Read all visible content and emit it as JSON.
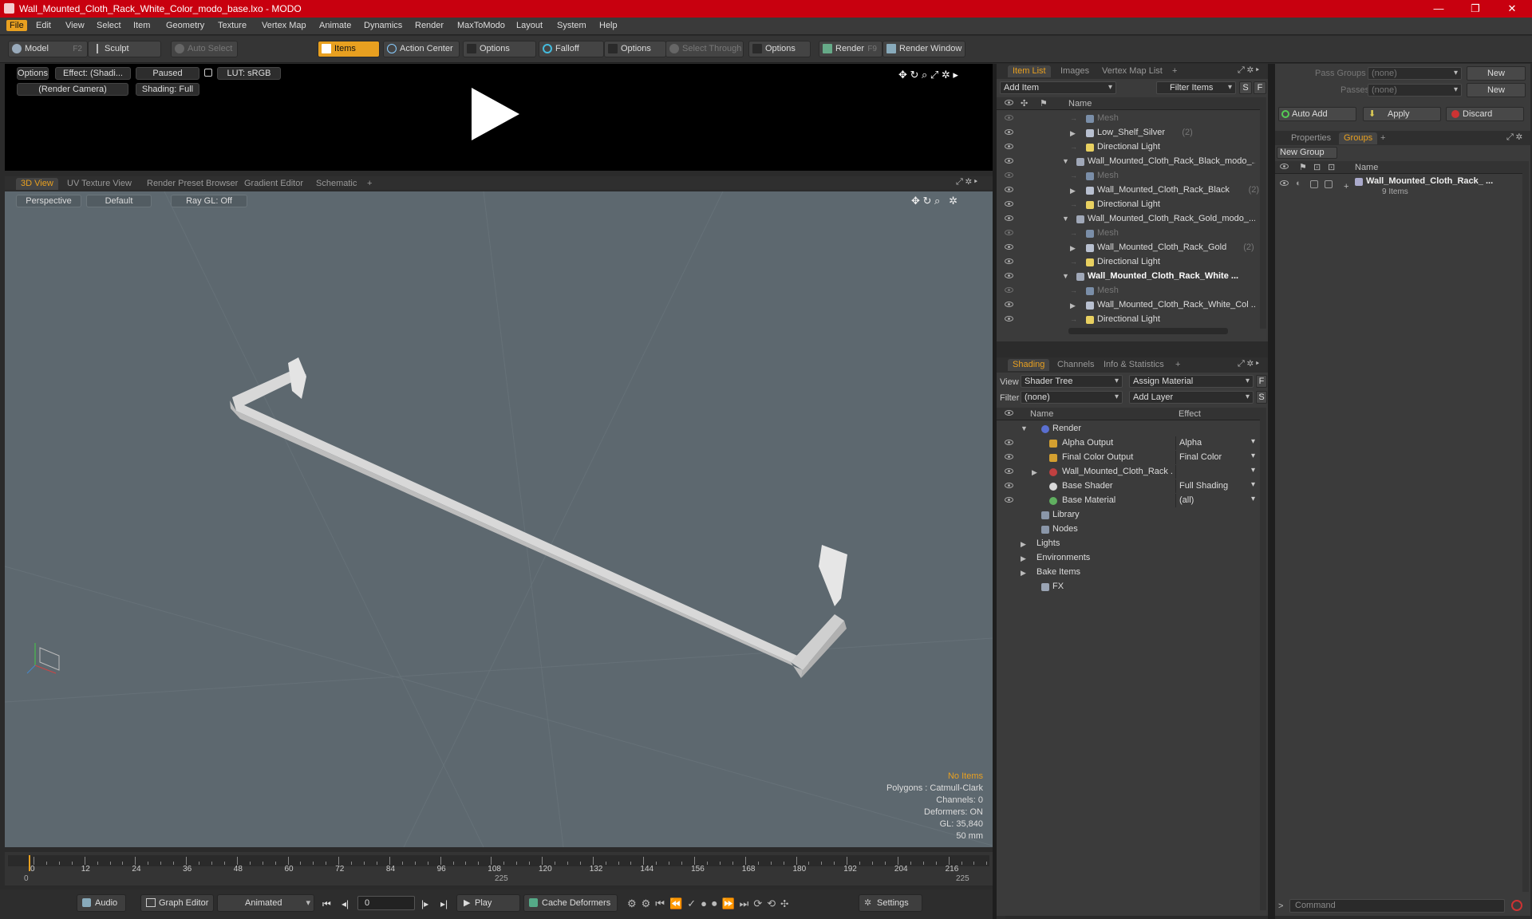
{
  "window": {
    "title": "Wall_Mounted_Cloth_Rack_White_Color_modo_base.lxo - MODO",
    "controls": [
      "—",
      "❐",
      "✕"
    ]
  },
  "menu": [
    "File",
    "Edit",
    "View",
    "Select",
    "Item",
    "Geometry",
    "Texture",
    "Vertex Map",
    "Animate",
    "Dynamics",
    "Render",
    "MaxToModo",
    "Layout",
    "System",
    "Help"
  ],
  "toolbar": {
    "model": "Model",
    "model_key": "F2",
    "sculpt": "Sculpt",
    "auto_select": "Auto Select",
    "items": "Items",
    "action_center": "Action Center",
    "options1": "Options",
    "falloff": "Falloff",
    "options2": "Options",
    "select_through": "Select Through",
    "options3": "Options",
    "render": "Render",
    "render_key": "F9",
    "render_window": "Render Window"
  },
  "preview": {
    "options": "Options",
    "effect": "Effect: (Shadi...",
    "paused": "Paused",
    "lut": "LUT: sRGB",
    "camera": "(Render Camera)",
    "shading": "Shading: Full"
  },
  "view_tabs": [
    "3D View",
    "UV Texture View",
    "Render Preset Browser",
    "Gradient Editor",
    "Schematic",
    "+"
  ],
  "viewport": {
    "perspective": "Perspective",
    "default": "Default",
    "raygl": "Ray GL: Off",
    "hud": {
      "no_items": "No Items",
      "polygons": "Polygons : Catmull-Clark",
      "channels": "Channels: 0",
      "deformers": "Deformers: ON",
      "gl": "GL: 35,840",
      "size": "50 mm"
    }
  },
  "timeline": {
    "ticks": [
      "0",
      "12",
      "24",
      "36",
      "48",
      "60",
      "72",
      "84",
      "96",
      "108",
      "120",
      "132",
      "144",
      "156",
      "168",
      "180",
      "192",
      "204",
      "216"
    ],
    "start": "0",
    "mid": "225",
    "end": "225"
  },
  "transport": {
    "audio": "Audio",
    "graph_editor": "Graph Editor",
    "animated": "Animated",
    "frame": "0",
    "play": "Play",
    "cache": "Cache Deformers",
    "settings": "Settings"
  },
  "item_list": {
    "tabs": [
      "Item List",
      "Images",
      "Vertex Map List",
      "+"
    ],
    "add_item": "Add Item",
    "filter_items": "Filter Items",
    "s": "S",
    "f": "F",
    "col_name": "Name",
    "rows": [
      {
        "label": "Mesh",
        "indent": 2,
        "kind": "mesh",
        "count": ""
      },
      {
        "label": "Low_Shelf_Silver",
        "indent": 2,
        "kind": "group",
        "count": "(2)"
      },
      {
        "label": "Directional Light",
        "indent": 2,
        "kind": "light",
        "count": ""
      },
      {
        "label": "Wall_Mounted_Cloth_Rack_Black_modo_...",
        "indent": 1,
        "kind": "scene",
        "count": ""
      },
      {
        "label": "Mesh",
        "indent": 2,
        "kind": "mesh",
        "count": ""
      },
      {
        "label": "Wall_Mounted_Cloth_Rack_Black",
        "indent": 2,
        "kind": "group",
        "count": "(2)"
      },
      {
        "label": "Directional Light",
        "indent": 2,
        "kind": "light",
        "count": ""
      },
      {
        "label": "Wall_Mounted_Cloth_Rack_Gold_modo_...",
        "indent": 1,
        "kind": "scene",
        "count": ""
      },
      {
        "label": "Mesh",
        "indent": 2,
        "kind": "mesh",
        "count": ""
      },
      {
        "label": "Wall_Mounted_Cloth_Rack_Gold",
        "indent": 2,
        "kind": "group",
        "count": "(2)"
      },
      {
        "label": "Directional Light",
        "indent": 2,
        "kind": "light",
        "count": ""
      },
      {
        "label": "Wall_Mounted_Cloth_Rack_White ...",
        "indent": 1,
        "kind": "scene-bold",
        "count": ""
      },
      {
        "label": "Mesh",
        "indent": 2,
        "kind": "mesh",
        "count": ""
      },
      {
        "label": "Wall_Mounted_Cloth_Rack_White_Col ...",
        "indent": 2,
        "kind": "group",
        "count": ""
      },
      {
        "label": "Directional Light",
        "indent": 2,
        "kind": "light",
        "count": ""
      }
    ]
  },
  "shading": {
    "tabs": [
      "Shading",
      "Channels",
      "Info & Statistics",
      "+"
    ],
    "view_label": "View",
    "view_value": "Shader Tree",
    "assign_material": "Assign Material",
    "f": "F",
    "filter_label": "Filter",
    "filter_value": "(none)",
    "add_layer": "Add Layer",
    "s": "S",
    "col_name": "Name",
    "col_effect": "Effect",
    "rows": [
      {
        "label": "Render",
        "effect": "",
        "indent": 0,
        "icon": "render"
      },
      {
        "label": "Alpha Output",
        "effect": "Alpha",
        "indent": 1,
        "icon": "output"
      },
      {
        "label": "Final Color Output",
        "effect": "Final Color",
        "indent": 1,
        "icon": "output"
      },
      {
        "label": "Wall_Mounted_Cloth_Rack ...",
        "effect": "",
        "indent": 1,
        "icon": "material-group"
      },
      {
        "label": "Base Shader",
        "effect": "Full Shading",
        "indent": 1,
        "icon": "shader"
      },
      {
        "label": "Base Material",
        "effect": "(all)",
        "indent": 1,
        "icon": "material"
      },
      {
        "label": "Library",
        "effect": "",
        "indent": 0,
        "icon": "folder"
      },
      {
        "label": "Nodes",
        "effect": "",
        "indent": 0,
        "icon": "folder"
      },
      {
        "label": "Lights",
        "effect": "",
        "indent": -1,
        "icon": "none"
      },
      {
        "label": "Environments",
        "effect": "",
        "indent": -1,
        "icon": "none"
      },
      {
        "label": "Bake Items",
        "effect": "",
        "indent": -1,
        "icon": "none"
      },
      {
        "label": "FX",
        "effect": "",
        "indent": 0,
        "icon": "fx"
      }
    ]
  },
  "groups": {
    "pass_groups": "Pass Groups",
    "pass_groups_value": "(none)",
    "new1": "New",
    "passes": "Passes",
    "passes_value": "(none)",
    "new2": "New",
    "auto_add": "Auto Add",
    "apply": "Apply",
    "discard": "Discard",
    "tabs": [
      "Properties",
      "Groups",
      "+"
    ],
    "new_group": "New Group",
    "col_name": "Name",
    "group_name": "Wall_Mounted_Cloth_Rack_ ...",
    "group_items": "9 Items",
    "command_placeholder": "Command"
  }
}
